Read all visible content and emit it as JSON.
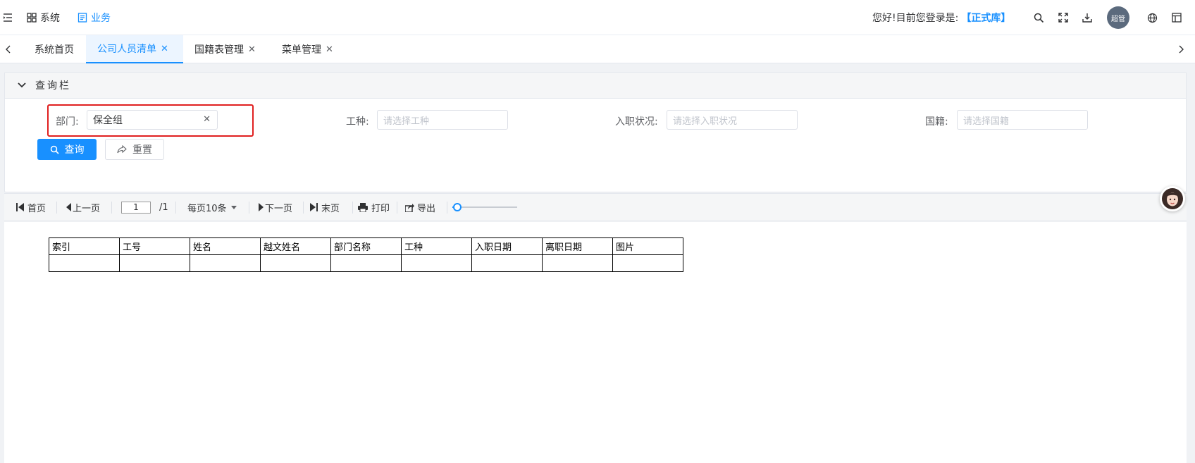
{
  "topbar": {
    "menu_system": "系统",
    "menu_business": "业务",
    "greeting_prefix": "您好!目前您登录是:",
    "db_name": "【正式库】",
    "avatar_text": "超管",
    "accent_color": "#1890ff"
  },
  "tabs": [
    {
      "label": "系统首页",
      "closable": false,
      "active": false
    },
    {
      "label": "公司人员清单",
      "closable": true,
      "active": true
    },
    {
      "label": "国籍表管理",
      "closable": true,
      "active": false
    },
    {
      "label": "菜单管理",
      "closable": true,
      "active": false
    }
  ],
  "query_panel": {
    "title": "查询栏",
    "fields": {
      "department": {
        "label": "部门:",
        "value": "保全组"
      },
      "job_type": {
        "label": "工种:",
        "placeholder": "请选择工种"
      },
      "employment_status": {
        "label": "入职状况:",
        "placeholder": "请选择入职状况"
      },
      "nationality": {
        "label": "国籍:",
        "placeholder": "请选择国籍"
      }
    },
    "query_button": "查询",
    "reset_button": "重置"
  },
  "report_toolbar": {
    "first": "首页",
    "prev": "上一页",
    "page_input": "1",
    "total_pages": "/1",
    "page_size": "每页10条",
    "next": "下一页",
    "last": "末页",
    "print": "打印",
    "export": "导出",
    "zoom_level": 0.08
  },
  "report_table": {
    "headers": [
      "索引",
      "工号",
      "姓名",
      "越文姓名",
      "部门名称",
      "工种",
      "入职日期",
      "离职日期",
      "图片"
    ],
    "rows": [
      [
        "",
        "",
        "",
        "",
        "",
        "",
        "",
        "",
        ""
      ]
    ]
  }
}
